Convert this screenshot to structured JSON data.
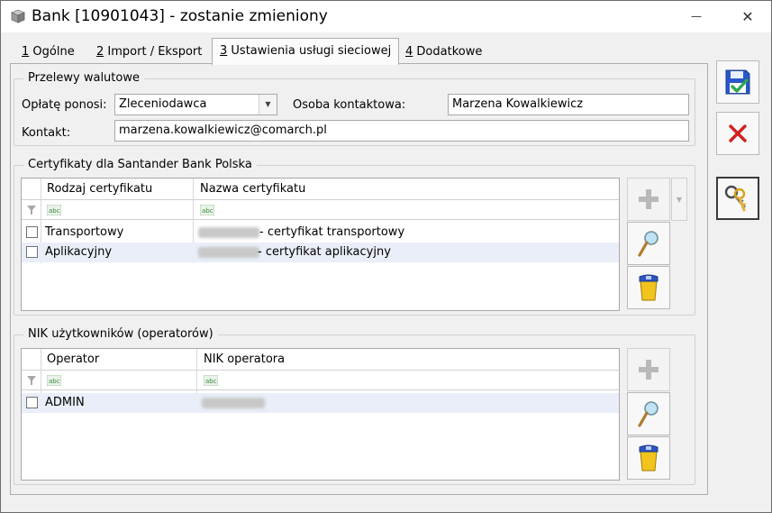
{
  "window": {
    "title": "Bank [10901043] - zostanie zmieniony",
    "minimize_glyph": "—",
    "close_glyph": "✕"
  },
  "tabs": [
    {
      "hotkey": "1",
      "label": " Ogólne"
    },
    {
      "hotkey": "2",
      "label": " Import / Eksport"
    },
    {
      "hotkey": "3",
      "label": " Ustawienia usługi sieciowej"
    },
    {
      "hotkey": "4",
      "label": " Dodatkowe"
    }
  ],
  "transfers": {
    "group_title": "Przelewy walutowe",
    "fee_label": "Opłatę ponosi:",
    "fee_value": "Zleceniodawca",
    "contact_person_label": "Osoba kontaktowa:",
    "contact_person_value": "Marzena Kowalkiewicz",
    "contact_label": "Kontakt:",
    "contact_value": "marzena.kowalkiewicz@comarch.pl"
  },
  "certificates": {
    "group_title": "Certyfikaty dla Santander Bank Polska",
    "columns": [
      "Rodzaj certyfikatu",
      "Nazwa certyfikatu"
    ],
    "rows": [
      {
        "type": "Transportowy",
        "name": "- certyfikat transportowy"
      },
      {
        "type": "Aplikacyjny",
        "name": "- certyfikat aplikacyjny"
      }
    ]
  },
  "operators": {
    "group_title": "NIK użytkowników (operatorów)",
    "columns": [
      "Operator",
      "NIK operatora"
    ],
    "rows": [
      {
        "operator": "ADMIN"
      }
    ]
  },
  "icons": {
    "save": "save-floppy-check-icon",
    "cancel": "cancel-x-icon",
    "keys": "keys-icon",
    "add": "plus-icon",
    "edit": "magnifier-icon",
    "delete": "trash-bin-icon"
  },
  "colors": {
    "save_blue": "#2a57c8",
    "check_green": "#2fa84f",
    "cancel_red": "#d21f1f",
    "selected_row": "#e9eef8"
  }
}
